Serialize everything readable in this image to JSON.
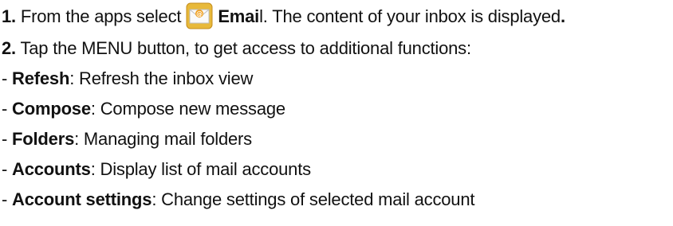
{
  "steps": [
    {
      "number": "1.",
      "text_before": "From the apps select",
      "icon": "email-app-icon",
      "emph": "Emai",
      "text_after": "l. The content of your inbox is displayed",
      "end_punct": "."
    },
    {
      "number": "2.",
      "text": "Tap the MENU button, to get access to additional functions:"
    }
  ],
  "menu_items": [
    {
      "prefix": "- ",
      "term": "Refesh",
      "desc": ": Refresh the inbox view"
    },
    {
      "prefix": "- ",
      "term": "Compose",
      "desc": ": Compose new message"
    },
    {
      "prefix": "- ",
      "term": "Folders",
      "desc": ": Managing mail folders"
    },
    {
      "prefix": "- ",
      "term": "Accounts",
      "desc": ": Display list of mail accounts"
    },
    {
      "prefix": "- ",
      "term": "Account settings",
      "desc": ": Change settings of selected mail account"
    }
  ],
  "colors": {
    "icon_bg": "#e8b93a",
    "icon_envelope": "#ffffff",
    "icon_at": "#f0a020"
  }
}
